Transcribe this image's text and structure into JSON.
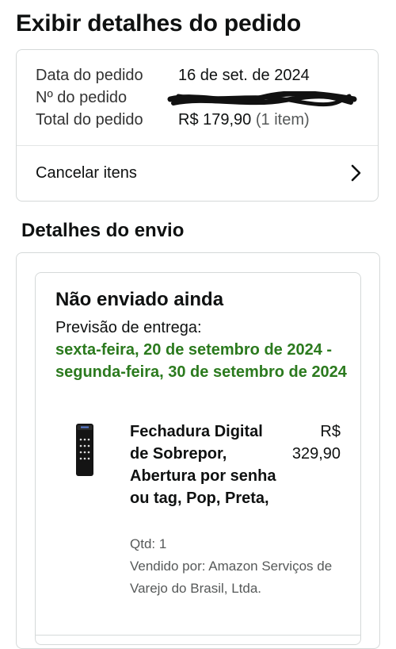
{
  "page": {
    "title": "Exibir detalhes do pedido"
  },
  "order": {
    "date_label": "Data do pedido",
    "date_value": "16 de set. de 2024",
    "number_label": "Nº do pedido",
    "total_label": "Total do pedido",
    "total_value": "R$ 179,90",
    "total_items": "(1 item)",
    "cancel_label": "Cancelar itens"
  },
  "shipping": {
    "section_title": "Detalhes do envio",
    "status": "Não enviado ainda",
    "delivery_label": "Previsão de entrega:",
    "delivery_dates": "sexta-feira, 20 de setembro de 2024 - segunda-feira, 30 de setembro de 2024",
    "delivery_color": "#2b7a1e"
  },
  "item": {
    "name": "Fechadura Digital de Sobrepor, Abertura por senha ou tag, Pop, Preta,",
    "price": "R$ 329,90",
    "qty": "Qtd: 1",
    "seller": "Vendido por: Amazon Serviços de Varejo do Brasil, Ltda."
  },
  "icons": {
    "chevron": "chevron-right-icon",
    "redaction": "redaction-scribble"
  }
}
